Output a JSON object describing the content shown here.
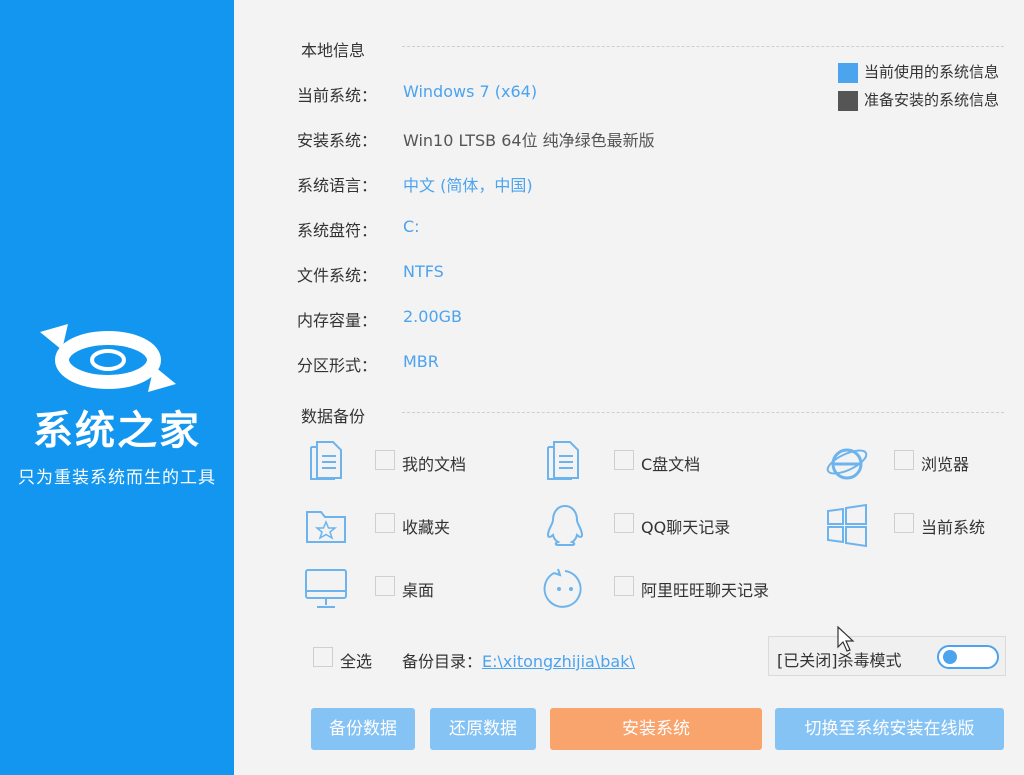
{
  "brand": {
    "title": "系统之家",
    "tagline": "只为重装系统而生的工具"
  },
  "local_info": {
    "section_title": "本地信息",
    "rows": [
      {
        "label": "当前系统：",
        "value": "Windows 7 (x64)"
      },
      {
        "label": "安装系统：",
        "value": "Win10 LTSB 64位 纯净绿色最新版"
      },
      {
        "label": "系统语言：",
        "value": "中文 (简体，中国)"
      },
      {
        "label": "系统盘符：",
        "value": "C:"
      },
      {
        "label": "文件系统：",
        "value": "NTFS"
      },
      {
        "label": "内存容量：",
        "value": "2.00GB"
      },
      {
        "label": "分区形式：",
        "value": "MBR"
      }
    ]
  },
  "legend": {
    "current": {
      "label": "当前使用的系统信息",
      "color": "#4ca3ee"
    },
    "pending": {
      "label": "准备安装的系统信息",
      "color": "#555555"
    }
  },
  "backup": {
    "section_title": "数据备份",
    "items": [
      {
        "label": "我的文档",
        "icon": "document-icon",
        "checked": false
      },
      {
        "label": "C盘文档",
        "icon": "document-icon",
        "checked": false
      },
      {
        "label": "浏览器",
        "icon": "ie-browser-icon",
        "checked": false
      },
      {
        "label": "收藏夹",
        "icon": "favorites-folder-icon",
        "checked": false
      },
      {
        "label": "QQ聊天记录",
        "icon": "qq-penguin-icon",
        "checked": false
      },
      {
        "label": "当前系统",
        "icon": "windows-logo-icon",
        "checked": false
      },
      {
        "label": "桌面",
        "icon": "monitor-icon",
        "checked": false
      },
      {
        "label": "阿里旺旺聊天记录",
        "icon": "aliwangwang-icon",
        "checked": false
      }
    ],
    "select_all": "全选",
    "dir_label": "备份目录：",
    "dir_path": "E:\\xitongzhijia\\bak\\",
    "antivirus_text": "[已关闭]杀毒模式",
    "antivirus_on": false
  },
  "buttons": {
    "backup": "备份数据",
    "restore": "还原数据",
    "install": "安装系统",
    "switch_online": "切换至系统安装在线版"
  }
}
